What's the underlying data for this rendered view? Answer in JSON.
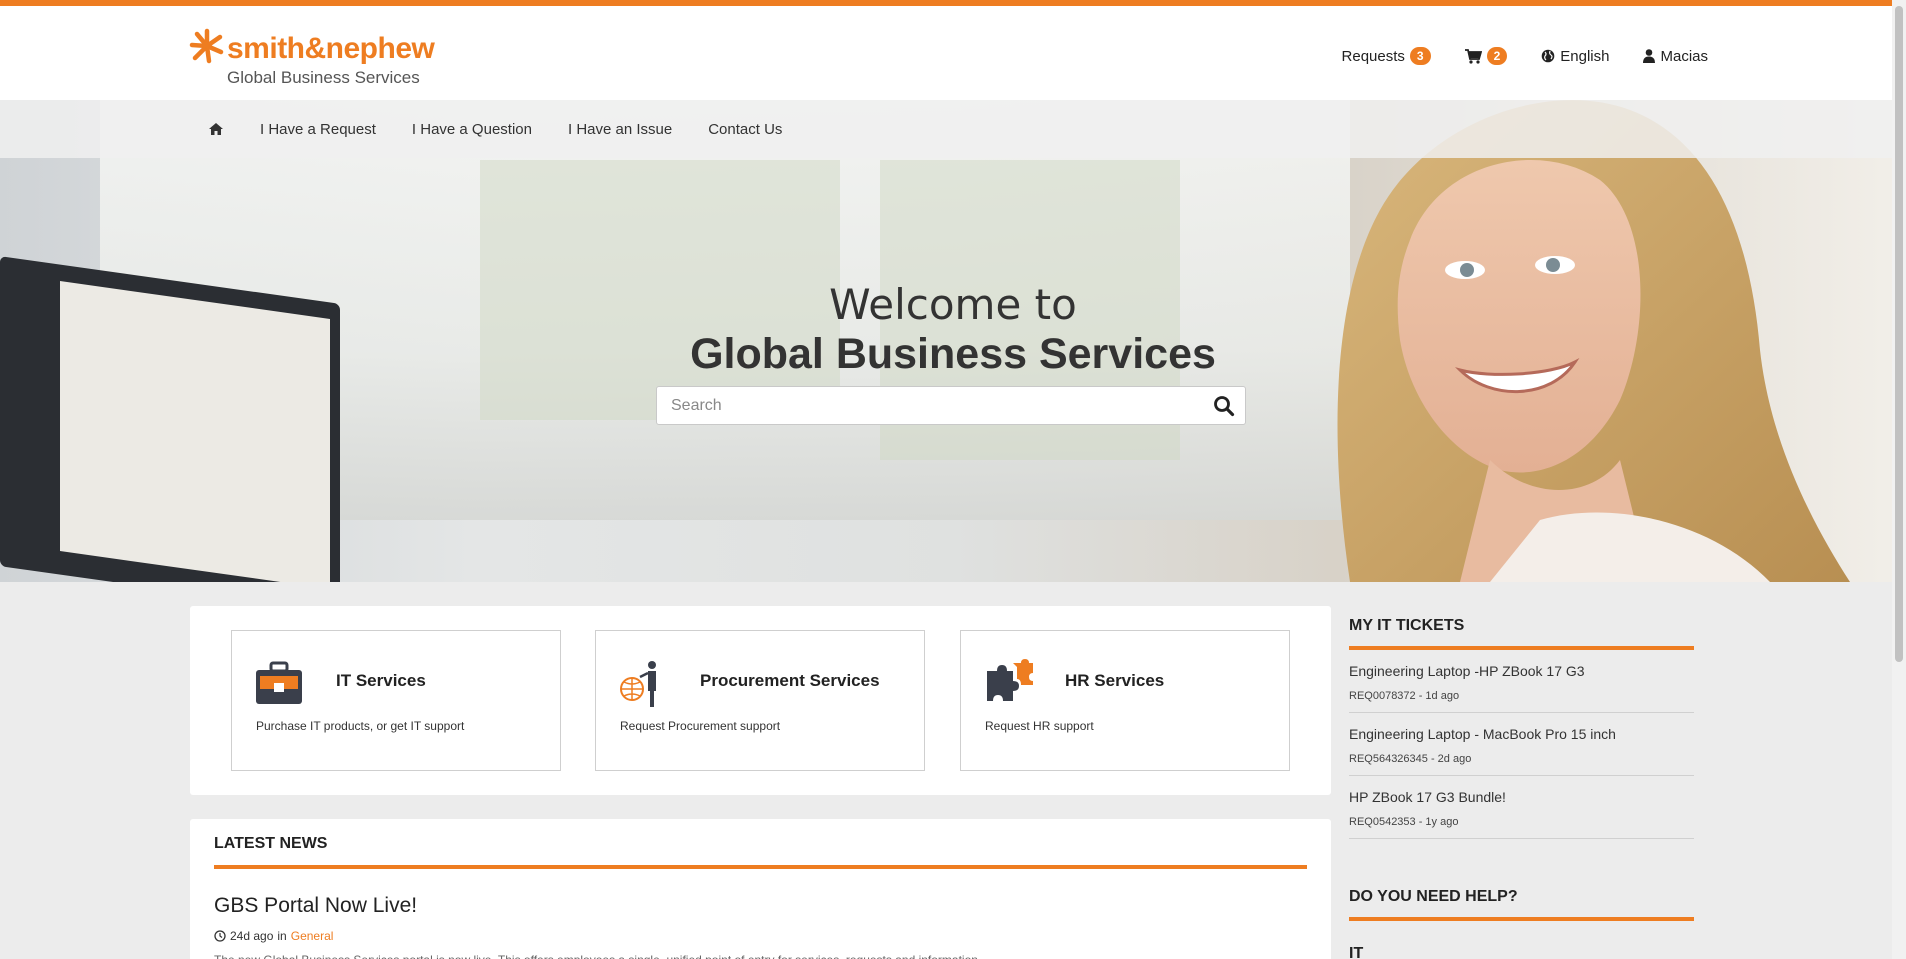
{
  "header": {
    "logo_brand": "smith&nephew",
    "logo_subtitle": "Global Business Services",
    "requests_label": "Requests",
    "requests_count": "3",
    "cart_count": "2",
    "language": "English",
    "user": "Macias"
  },
  "nav": {
    "items": [
      "I Have a Request",
      "I Have a Question",
      "I Have an Issue",
      "Contact Us"
    ]
  },
  "hero": {
    "welcome_line1": "Welcome to",
    "welcome_line2": "Global Business Services",
    "search_placeholder": "Search"
  },
  "services": [
    {
      "title": "IT Services",
      "description": "Purchase IT products, or get IT support",
      "icon": "toolbox-icon"
    },
    {
      "title": "Procurement Services",
      "description": "Request Procurement support",
      "icon": "globe-presenter-icon"
    },
    {
      "title": "HR Services",
      "description": "Request HR support",
      "icon": "puzzle-icon"
    }
  ],
  "news": {
    "heading": "LATEST NEWS",
    "title": "GBS Portal Now Live!",
    "age": "24d ago",
    "in_label": "in",
    "category": "General",
    "excerpt": "The new Global Business Services portal is now live. This offers employees a single, unified point of entry for services, requests and information."
  },
  "my_tickets": {
    "heading": "MY IT TICKETS",
    "items": [
      {
        "title": "Engineering Laptop -HP ZBook 17 G3",
        "meta": "REQ0078372 - 1d ago"
      },
      {
        "title": "Engineering Laptop - MacBook Pro 15 inch",
        "meta": "REQ564326345 - 2d ago"
      },
      {
        "title": "HP ZBook 17 G3 Bundle!",
        "meta": "REQ0542353 - 1y ago"
      }
    ]
  },
  "help": {
    "heading": "DO YOU NEED HELP?",
    "first_category": "IT"
  },
  "colors": {
    "accent": "#ee7d21",
    "page_bg": "#ececec"
  }
}
